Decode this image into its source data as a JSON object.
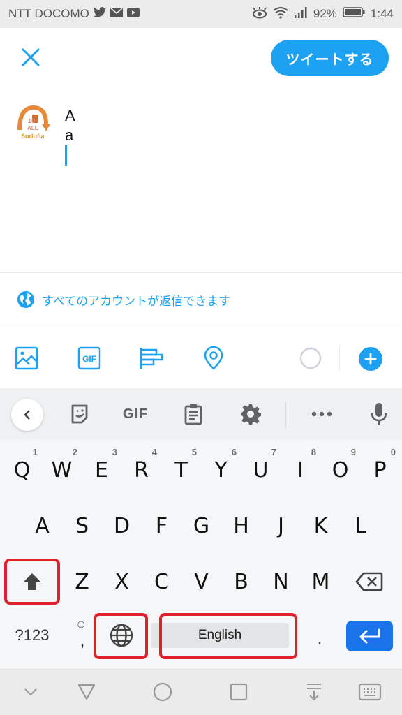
{
  "status_bar": {
    "carrier": "NTT DOCOMO",
    "notification_icons": [
      "twitter-icon",
      "mail-icon",
      "youtube-icon"
    ],
    "system_icons": [
      "eye-comfort-icon",
      "wifi-icon",
      "signal-icon",
      "battery-icon"
    ],
    "battery": "92%",
    "time": "1:44"
  },
  "compose": {
    "close_icon": "close-icon",
    "tweet_button": "ツイートする",
    "avatar_label": "Surlofia",
    "avatar_badge_top": "10",
    "avatar_badge_mid": "ALL",
    "text": "A\na",
    "reply_setting": "すべてのアカウントが返信できます",
    "toolbar_icons": [
      "image-icon",
      "gif-icon",
      "poll-icon",
      "location-icon",
      "character-counter",
      "add-tweet-icon"
    ],
    "accent_color": "#1da1f2"
  },
  "keyboard": {
    "toolbar": [
      "back",
      "sticker",
      "GIF",
      "clipboard",
      "settings",
      "more",
      "voice"
    ],
    "gif_label": "GIF",
    "rows": [
      [
        {
          "k": "Q",
          "h": "1"
        },
        {
          "k": "W",
          "h": "2"
        },
        {
          "k": "E",
          "h": "3"
        },
        {
          "k": "R",
          "h": "4"
        },
        {
          "k": "T",
          "h": "5"
        },
        {
          "k": "Y",
          "h": "6"
        },
        {
          "k": "U",
          "h": "7"
        },
        {
          "k": "I",
          "h": "8"
        },
        {
          "k": "O",
          "h": "9"
        },
        {
          "k": "P",
          "h": "0"
        }
      ],
      [
        {
          "k": "A"
        },
        {
          "k": "S"
        },
        {
          "k": "D"
        },
        {
          "k": "F"
        },
        {
          "k": "G"
        },
        {
          "k": "H"
        },
        {
          "k": "J"
        },
        {
          "k": "K"
        },
        {
          "k": "L"
        }
      ],
      [
        {
          "k": "Z"
        },
        {
          "k": "X"
        },
        {
          "k": "C"
        },
        {
          "k": "V"
        },
        {
          "k": "B"
        },
        {
          "k": "N"
        },
        {
          "k": "M"
        }
      ]
    ],
    "symbols_key": "?123",
    "comma_key": ",",
    "period_key": ".",
    "space_label": "English",
    "enter_color": "#1a73e8",
    "highlight_color": "#e0202a",
    "highlighted_keys": [
      "shift",
      "language",
      "space"
    ]
  },
  "nav_bar": {
    "buttons": [
      "hide-keyboard",
      "back",
      "home",
      "recents",
      "notification-pull",
      "keyboard-switch"
    ]
  }
}
